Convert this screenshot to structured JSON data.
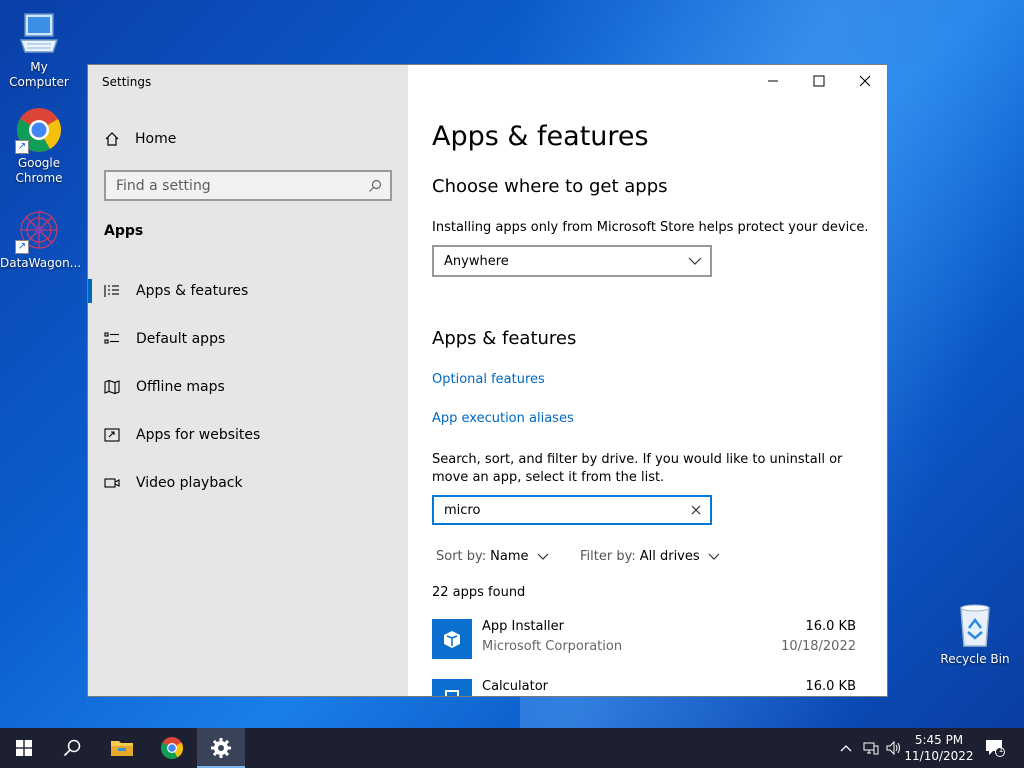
{
  "desktop": {
    "icons": [
      {
        "label": "My Computer",
        "icon": "computer-icon"
      },
      {
        "label": "Google Chrome",
        "icon": "chrome-icon"
      },
      {
        "label": "DataWagon...",
        "icon": "datawagon-icon"
      },
      {
        "label": "Recycle Bin",
        "icon": "recycle-bin-icon"
      }
    ]
  },
  "window": {
    "title": "Settings",
    "controls": {
      "minimize": "minimize-icon",
      "maximize": "maximize-icon",
      "close": "close-icon"
    }
  },
  "sidebar": {
    "home_label": "Home",
    "search_placeholder": "Find a setting",
    "section_title": "Apps",
    "items": [
      {
        "label": "Apps & features",
        "icon": "list-icon",
        "active": true
      },
      {
        "label": "Default apps",
        "icon": "default-apps-icon",
        "active": false
      },
      {
        "label": "Offline maps",
        "icon": "map-icon",
        "active": false
      },
      {
        "label": "Apps for websites",
        "icon": "website-app-icon",
        "active": false
      },
      {
        "label": "Video playback",
        "icon": "video-icon",
        "active": false
      }
    ]
  },
  "main": {
    "page_title": "Apps & features",
    "choose_heading": "Choose where to get apps",
    "choose_desc": "Installing apps only from Microsoft Store helps protect your device.",
    "source_selected": "Anywhere",
    "section_heading": "Apps & features",
    "link_optional": "Optional features",
    "link_aliases": "App execution aliases",
    "search_desc": "Search, sort, and filter by drive. If you would like to uninstall or move an app, select it from the list.",
    "search_value": "micro",
    "sort_label": "Sort by:",
    "sort_value": "Name",
    "filter_label": "Filter by:",
    "filter_value": "All drives",
    "count_text": "22 apps found",
    "apps": [
      {
        "name": "App Installer",
        "publisher": "Microsoft Corporation",
        "size": "16.0 KB",
        "date": "10/18/2022"
      },
      {
        "name": "Calculator",
        "publisher": "",
        "size": "16.0 KB",
        "date": ""
      }
    ]
  },
  "taskbar": {
    "items": [
      "start-icon",
      "search-icon",
      "file-explorer-icon",
      "chrome-icon",
      "settings-icon"
    ],
    "clock_time": "5:45 PM",
    "clock_date": "11/10/2022",
    "notification_count": "1"
  },
  "colors": {
    "accent": "#0067c0",
    "sidebar_bg": "#e6e6e6",
    "taskbar_bg": "#1c2030"
  }
}
